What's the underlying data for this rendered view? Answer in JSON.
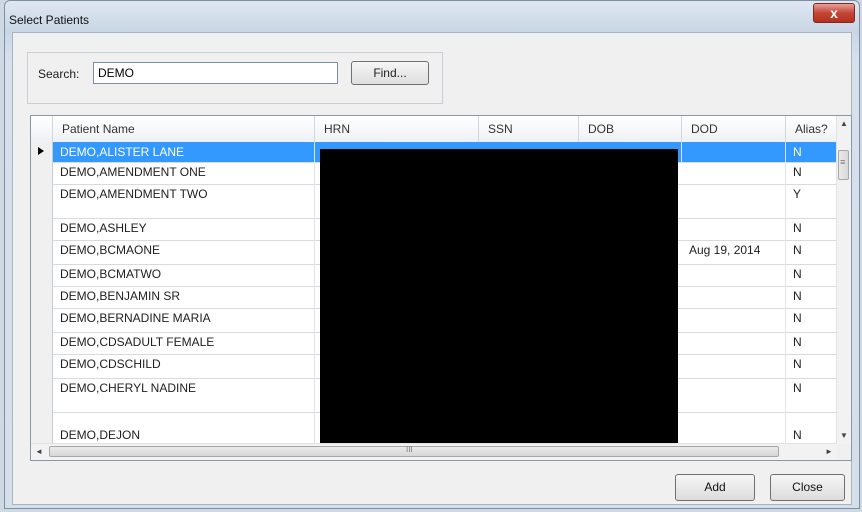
{
  "window": {
    "title": "Select Patients",
    "close_glyph": "x"
  },
  "search": {
    "label": "Search:",
    "value": "DEMO",
    "find_label": "Find..."
  },
  "grid": {
    "columns": [
      "Patient Name",
      "HRN",
      "SSN",
      "DOB",
      "DOD",
      "Alias?"
    ],
    "rows": [
      {
        "name": "DEMO,ALISTER LANE",
        "dod": "",
        "alias": "N",
        "selected": true
      },
      {
        "name": "DEMO,AMENDMENT ONE",
        "dod": "",
        "alias": "N"
      },
      {
        "name": "DEMO,AMENDMENT TWO",
        "dod": "",
        "alias": "Y"
      },
      {
        "name": "DEMO,ASHLEY",
        "dod": "",
        "alias": "N"
      },
      {
        "name": "DEMO,BCMAONE",
        "dod": "Aug 19, 2014",
        "alias": "N"
      },
      {
        "name": "DEMO,BCMATWO",
        "dod": "",
        "alias": "N"
      },
      {
        "name": "DEMO,BENJAMIN SR",
        "dod": "",
        "alias": "N"
      },
      {
        "name": "DEMO,BERNADINE MARIA",
        "dod": "",
        "alias": "N"
      },
      {
        "name": "DEMO,CDSADULT FEMALE",
        "dod": "",
        "alias": "N"
      },
      {
        "name": "DEMO,CDSCHILD",
        "dod": "",
        "alias": "N"
      },
      {
        "name": "DEMO,CHERYL NADINE",
        "dod": "",
        "alias": "N"
      },
      {
        "name": "DEMO,DEJON",
        "dod": "",
        "alias": "N"
      }
    ],
    "scroll": {
      "up": "▲",
      "down": "▼",
      "left": "◄",
      "right": "►",
      "hgrip": "III",
      "vgrip": "≡"
    }
  },
  "buttons": {
    "add": "Add",
    "close": "Close"
  },
  "colors": {
    "selection": "#3399ff",
    "redaction": "#000000"
  }
}
